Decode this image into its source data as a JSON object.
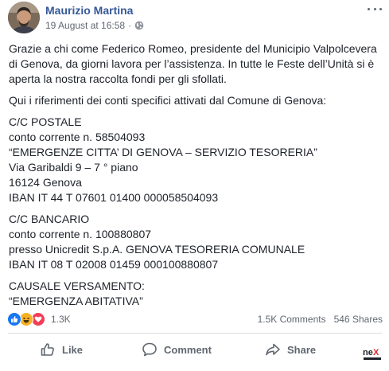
{
  "post": {
    "author": "Maurizio Martina",
    "timestamp": "19 August at 16:58",
    "dot": "·",
    "audience_icon": "globe-icon",
    "more_icon": "ellipsis-icon"
  },
  "content": {
    "intro": [
      "Grazie a chi come Federico Romeo, presidente del Municipio Valpolcevera",
      "di Genova, da giorni lavora per l’assistenza. In tutte le Feste dell’Unità si è",
      "aperta la nostra raccolta fondi per gli sfollati."
    ],
    "refs_intro": "Qui i riferimenti dei conti specifici attivati dal Comune di Genova:",
    "postale": [
      "C/C POSTALE",
      "conto corrente n. 58504093",
      "“EMERGENZE CITTA’ DI GENOVA – SERVIZIO TESORERIA”",
      "Via Garibaldi 9 – 7 ° piano",
      "16124 Genova",
      "IBAN IT 44 T 07601 01400 000058504093"
    ],
    "bancario": [
      "C/C BANCARIO",
      "conto corrente n. 100880807",
      "presso Unicredit S.p.A. GENOVA TESORERIA COMUNALE",
      "IBAN IT 08 T 02008 01459 000100880807"
    ],
    "causale": [
      "CAUSALE VERSAMENTO:",
      "“EMERGENZA ABITATIVA”"
    ]
  },
  "stats": {
    "reactions": "1.3K",
    "reaction_icons": [
      "like-icon",
      "haha-icon",
      "love-icon"
    ],
    "comments": "1.5K Comments",
    "shares": "546 Shares"
  },
  "actions": {
    "like": "Like",
    "comment": "Comment",
    "share": "Share"
  },
  "colors": {
    "name": "#365899",
    "text": "#1d2129",
    "muted": "#606770",
    "like_blue": "#1877f2",
    "love_red": "#f33e58",
    "haha_yellow": "#f7b125"
  }
}
